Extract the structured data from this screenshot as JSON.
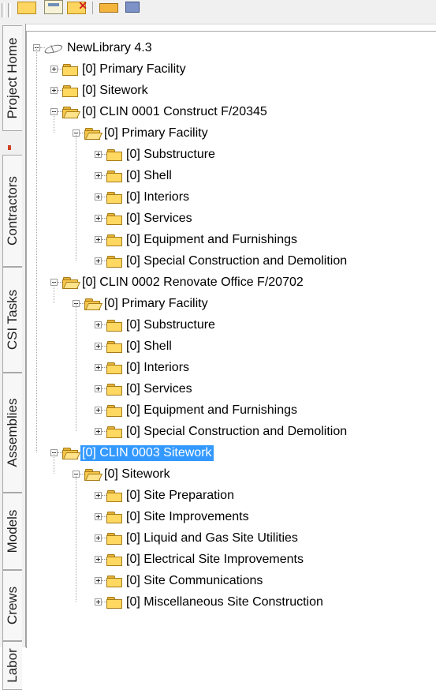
{
  "toolbar": {
    "buttons": [
      {
        "icon": "open-folder-icon"
      },
      {
        "icon": "save-icon"
      },
      {
        "icon": "delete-folder-icon"
      },
      {
        "icon": "link-icon"
      },
      {
        "icon": "find-icon"
      }
    ]
  },
  "side_tabs": [
    "Project Home",
    "Contractors",
    "CSI Tasks",
    "Assemblies",
    "Models",
    "Crews",
    "Labor"
  ],
  "tree": {
    "root": {
      "label": "NewLibrary 4.3",
      "icon": "library-icon"
    },
    "nodes": [
      {
        "label": "[0] Primary Facility",
        "level": 1,
        "open": false
      },
      {
        "label": "[0] Sitework",
        "level": 1,
        "open": false
      },
      {
        "label": "[0] CLIN 0001 Construct F/20345",
        "level": 1,
        "open": true
      },
      {
        "label": "[0] Primary Facility",
        "level": 2,
        "open": true
      },
      {
        "label": "[0] Substructure",
        "level": 3,
        "open": false
      },
      {
        "label": "[0] Shell",
        "level": 3,
        "open": false
      },
      {
        "label": "[0] Interiors",
        "level": 3,
        "open": false
      },
      {
        "label": "[0] Services",
        "level": 3,
        "open": false
      },
      {
        "label": "[0] Equipment and Furnishings",
        "level": 3,
        "open": false
      },
      {
        "label": "[0] Special Construction and Demolition",
        "level": 3,
        "open": false
      },
      {
        "label": "[0] CLIN 0002 Renovate Office F/20702",
        "level": 1,
        "open": true
      },
      {
        "label": "[0] Primary Facility",
        "level": 2,
        "open": true
      },
      {
        "label": "[0] Substructure",
        "level": 3,
        "open": false
      },
      {
        "label": "[0] Shell",
        "level": 3,
        "open": false
      },
      {
        "label": "[0] Interiors",
        "level": 3,
        "open": false
      },
      {
        "label": "[0] Services",
        "level": 3,
        "open": false
      },
      {
        "label": "[0] Equipment and Furnishings",
        "level": 3,
        "open": false
      },
      {
        "label": "[0] Special Construction and Demolition",
        "level": 3,
        "open": false
      },
      {
        "label": "[0] CLIN 0003 Sitework",
        "level": 1,
        "open": true,
        "selected": true
      },
      {
        "label": "[0] Sitework",
        "level": 2,
        "open": true
      },
      {
        "label": "[0] Site Preparation",
        "level": 3,
        "open": false
      },
      {
        "label": "[0] Site Improvements",
        "level": 3,
        "open": false
      },
      {
        "label": "[0] Liquid and Gas Site Utilities",
        "level": 3,
        "open": false
      },
      {
        "label": "[0] Electrical Site Improvements",
        "level": 3,
        "open": false
      },
      {
        "label": "[0] Site Communications",
        "level": 3,
        "open": false
      },
      {
        "label": "[0] Miscellaneous Site Construction",
        "level": 3,
        "open": false
      }
    ]
  },
  "colors": {
    "selection": "#3399ff",
    "folder": "#ffd861"
  }
}
